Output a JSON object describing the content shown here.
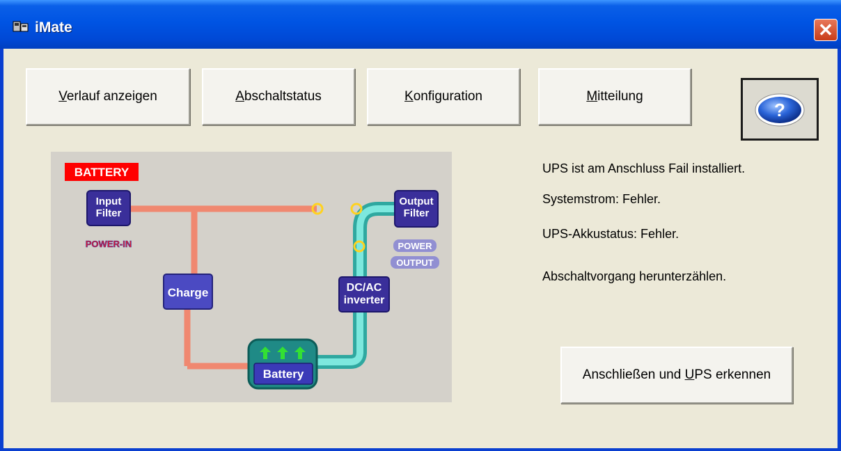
{
  "window": {
    "title": "iMate",
    "close_glyph": "✕"
  },
  "toolbar": {
    "history": {
      "pre": "",
      "key": "V",
      "post": "erlauf anzeigen"
    },
    "shutdown_status": {
      "pre": "",
      "key": "A",
      "post": "bschaltstatus"
    },
    "configuration": {
      "pre": "",
      "key": "K",
      "post": "onfiguration"
    },
    "notification": {
      "pre": "",
      "key": "M",
      "post": "itteilung"
    },
    "help_icon": "help-icon"
  },
  "diagram": {
    "mode_badge": "BATTERY",
    "input_filter": [
      "Input",
      "Filter"
    ],
    "power_in": "POWER-IN",
    "charge": "Charge",
    "battery": "Battery",
    "inverter": [
      "DC/AC",
      "inverter"
    ],
    "output_filter": [
      "Output",
      "Filter"
    ],
    "power_output": [
      "POWER",
      "OUTPUT"
    ],
    "colors": {
      "ac_line": "#f08870",
      "dc_line": "#5ed6cc",
      "block": "#3a2f9a",
      "badge": "#ff0000"
    }
  },
  "status": {
    "line1": "UPS ist am Anschluss  Fail installiert.",
    "line2": "Systemstrom: Fehler.",
    "line3": "UPS-Akkustatus: Fehler.",
    "line4": "Abschaltvorgang herunterzählen."
  },
  "connect_button": {
    "pre": "Anschließen und ",
    "key": "U",
    "post": "PS erkennen"
  }
}
